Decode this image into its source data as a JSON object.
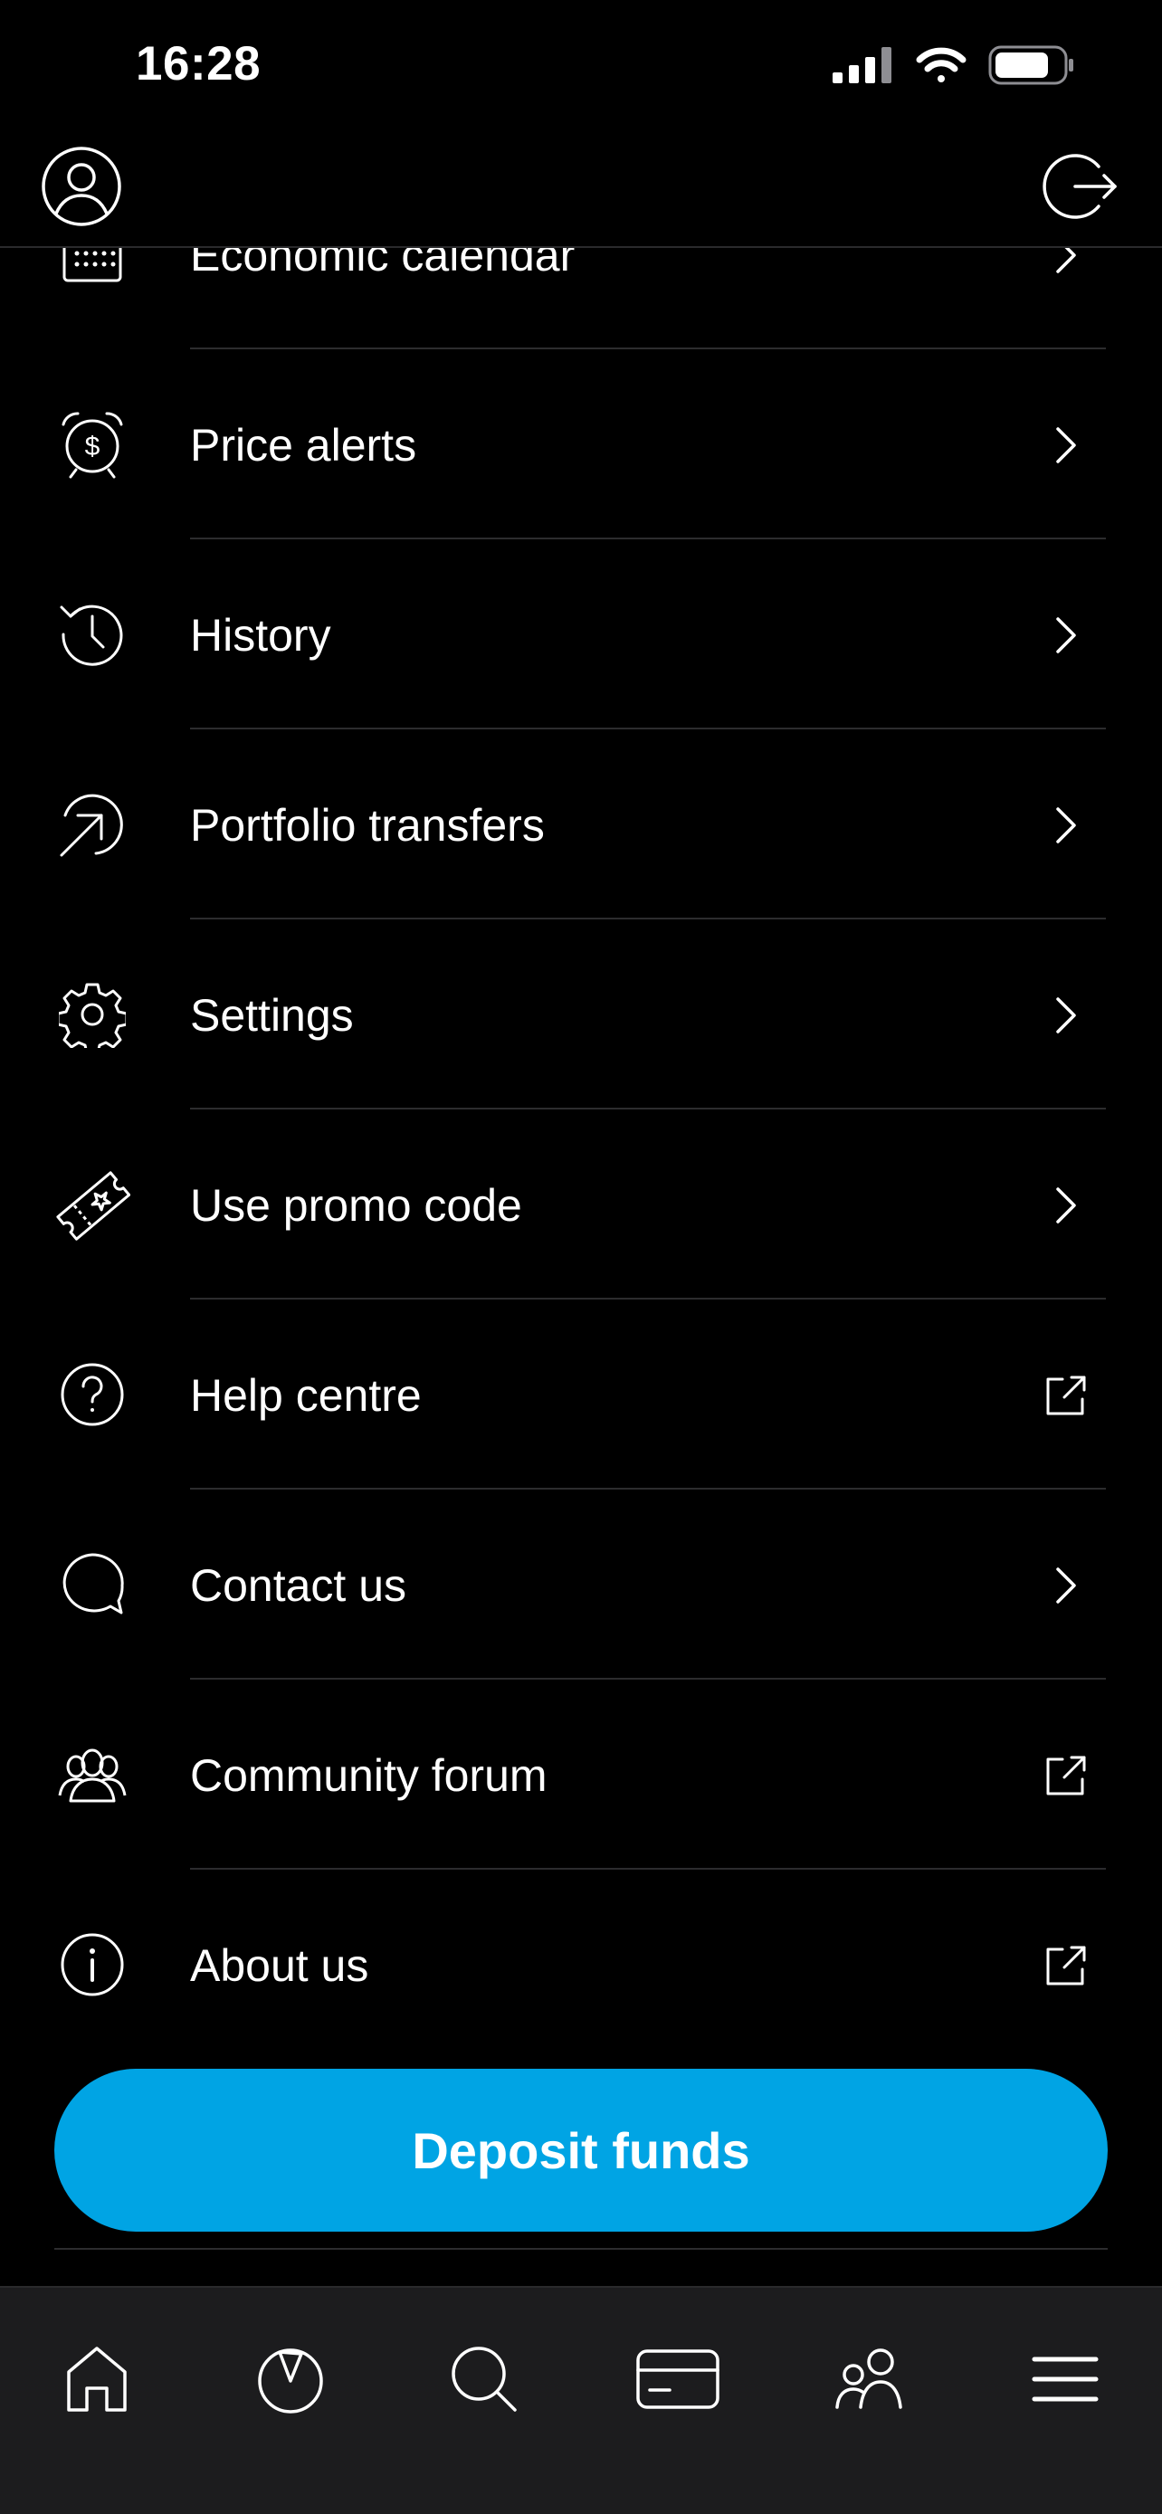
{
  "status_bar": {
    "time": "16:28",
    "icons": [
      "signal-icon",
      "wifi-icon",
      "battery-icon"
    ]
  },
  "header": {
    "left_icon": "profile-icon",
    "right_icon": "logout-icon"
  },
  "menu": {
    "items": [
      {
        "label": "Economic calendar",
        "icon": "calendar-icon",
        "trailing": "chevron-right-icon"
      },
      {
        "label": "Price alerts",
        "icon": "alarm-dollar-icon",
        "trailing": "chevron-right-icon"
      },
      {
        "label": "History",
        "icon": "history-clock-icon",
        "trailing": "chevron-right-icon"
      },
      {
        "label": "Portfolio transfers",
        "icon": "transfer-arrow-icon",
        "trailing": "chevron-right-icon"
      },
      {
        "label": "Settings",
        "icon": "gear-icon",
        "trailing": "chevron-right-icon"
      },
      {
        "label": "Use promo code",
        "icon": "ticket-star-icon",
        "trailing": "chevron-right-icon"
      },
      {
        "label": "Help centre",
        "icon": "question-circle-icon",
        "trailing": "external-link-icon"
      },
      {
        "label": "Contact us",
        "icon": "chat-bubble-icon",
        "trailing": "chevron-right-icon"
      },
      {
        "label": "Community forum",
        "icon": "people-group-icon",
        "trailing": "external-link-icon"
      },
      {
        "label": "About us",
        "icon": "info-circle-icon",
        "trailing": "external-link-icon"
      }
    ]
  },
  "deposit": {
    "label": "Deposit funds"
  },
  "tabbar": {
    "tabs": [
      {
        "icon": "home-icon"
      },
      {
        "icon": "portfolio-pie-icon"
      },
      {
        "icon": "search-icon"
      },
      {
        "icon": "card-icon"
      },
      {
        "icon": "community-icon"
      },
      {
        "icon": "menu-icon"
      }
    ]
  },
  "colors": {
    "background": "#000000",
    "accent": "#00a4e4",
    "tabbar": "#1c1c1e",
    "divider": "#2c2c2e",
    "text": "#ffffff"
  }
}
